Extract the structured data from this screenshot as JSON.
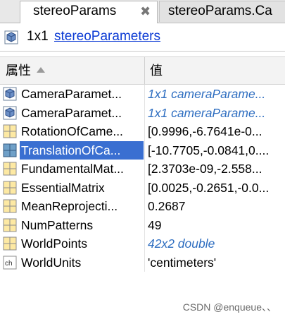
{
  "tabs": [
    {
      "label": "stereoParams",
      "close": "✖",
      "active": true
    },
    {
      "label": "stereoParams.Ca",
      "active": false
    }
  ],
  "summary": {
    "size": "1x1",
    "class_link": "stereoParameters"
  },
  "columns": {
    "property": "属性",
    "value": "值"
  },
  "rows": [
    {
      "name": "CameraParamet...",
      "value": "1x1 cameraParame...",
      "icon": "object-icon",
      "meta": true
    },
    {
      "name": "CameraParamet...",
      "value": "1x1 cameraParame...",
      "icon": "object-icon",
      "meta": true
    },
    {
      "name": "RotationOfCame...",
      "value": "[0.9996,-6.7641e-0...",
      "icon": "matrix-icon",
      "meta": false
    },
    {
      "name": "TranslationOfCa...",
      "value": "[-10.7705,-0.0841,0....",
      "icon": "matrix-icon",
      "meta": false,
      "selected": true
    },
    {
      "name": "FundamentalMat...",
      "value": "[2.3703e-09,-2.558...",
      "icon": "matrix-icon",
      "meta": false
    },
    {
      "name": "EssentialMatrix",
      "value": "[0.0025,-0.2651,-0.0...",
      "icon": "matrix-icon",
      "meta": false
    },
    {
      "name": "MeanReprojecti...",
      "value": "0.2687",
      "icon": "matrix-icon",
      "meta": false
    },
    {
      "name": "NumPatterns",
      "value": "49",
      "icon": "matrix-icon",
      "meta": false
    },
    {
      "name": "WorldPoints",
      "value": "42x2 double",
      "icon": "matrix-icon",
      "meta": true
    },
    {
      "name": "WorldUnits",
      "value": "'centimeters'",
      "icon": "char-icon",
      "meta": false
    }
  ],
  "watermark": "CSDN @enqueue、、",
  "colors": {
    "link": "#0b3ad4",
    "selection": "#3a6fd1",
    "meta_value": "#2d6dc0"
  }
}
